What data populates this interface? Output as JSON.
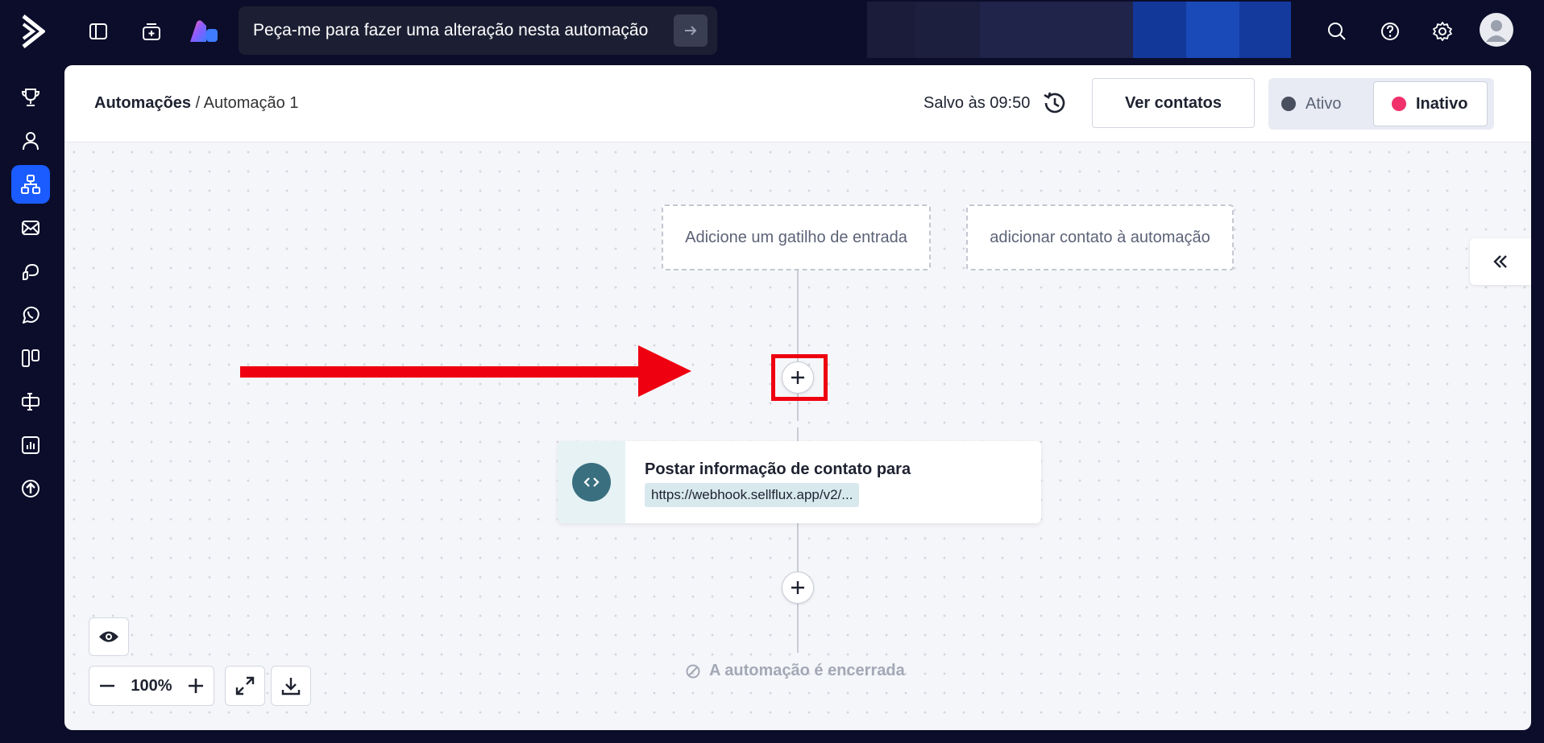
{
  "topbar": {
    "prompt_text": "Peça-me para fazer uma alteração nesta automação",
    "icons": [
      "logo-icon",
      "panel-toggle-icon",
      "ai-builder-icon",
      "brand-app-icon",
      "arrow-right-icon",
      "search-icon",
      "help-icon",
      "gear-icon",
      "avatar-icon"
    ],
    "banner_colors": [
      "#1a1c3a",
      "#1c1f3e",
      "#20244a",
      "#12399a",
      "#1a4ab8",
      "#143a9e"
    ]
  },
  "sidebar": {
    "items": [
      "trophy-icon",
      "contacts-icon",
      "automation-icon",
      "email-icon",
      "conversations-icon",
      "whatsapp-icon",
      "pipeline-icon",
      "forms-icon",
      "reports-icon",
      "upgrade-icon"
    ],
    "active_index": 2
  },
  "header": {
    "breadcrumb_root": "Automações",
    "breadcrumb_sep": " / ",
    "breadcrumb_current": "Automação 1",
    "saved_text": "Salvo às 09:50",
    "contacts_button": "Ver contatos",
    "status_active": "Ativo",
    "status_inactive": "Inativo",
    "colors": {
      "active_dot": "#4a4f60",
      "inactive_dot": "#f0306a"
    }
  },
  "canvas": {
    "trigger_entry": "Adicione um gatilho de entrada",
    "trigger_add_contact": "adicionar contato à automação",
    "action_title": "Postar informação de contato para",
    "action_url": "https://webhook.sellflux.app/v2/...",
    "end_text": "A automação é encerrada",
    "zoom_level": "100%",
    "annotation_color": "#ee0010"
  }
}
